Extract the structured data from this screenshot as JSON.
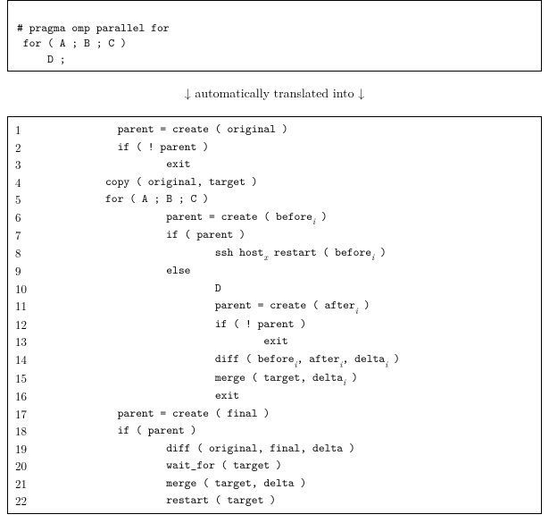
{
  "source_block": {
    "line1": "# pragma omp parallel for",
    "line2": " for ( A ; B ; C )",
    "line3": "     D ;"
  },
  "caption": {
    "arrow_left": "↓",
    "text": " automatically translated into ",
    "arrow_right": "↓"
  },
  "translated_block": {
    "lines": [
      {
        "n": "1",
        "indent": "        ",
        "text": "parent = create ( original )"
      },
      {
        "n": "2",
        "indent": "        ",
        "text": "if ( ! parent )"
      },
      {
        "n": "3",
        "indent": "                ",
        "text": "exit"
      },
      {
        "n": "4",
        "indent": "      ",
        "text": "copy ( original, target )"
      },
      {
        "n": "5",
        "indent": "      ",
        "text": "for ( A ; B ; C )"
      },
      {
        "n": "6",
        "indent": "                ",
        "text_parts": [
          "parent = create ( before",
          {
            "sub": "i"
          },
          " )"
        ]
      },
      {
        "n": "7",
        "indent": "                ",
        "text": "if ( parent )"
      },
      {
        "n": "8",
        "indent": "                        ",
        "text_parts": [
          "ssh host",
          {
            "sub": "x"
          },
          " restart ( before",
          {
            "sub": "i"
          },
          " )"
        ]
      },
      {
        "n": "9",
        "indent": "                ",
        "text": "else"
      },
      {
        "n": "10",
        "indent": "                        ",
        "text": "D"
      },
      {
        "n": "11",
        "indent": "                        ",
        "text_parts": [
          "parent = create ( after",
          {
            "sub": "i"
          },
          " )"
        ]
      },
      {
        "n": "12",
        "indent": "                        ",
        "text": "if ( ! parent )"
      },
      {
        "n": "13",
        "indent": "                                ",
        "text": "exit"
      },
      {
        "n": "14",
        "indent": "                        ",
        "text_parts": [
          "diff ( before",
          {
            "sub": "i"
          },
          ", after",
          {
            "sub": "i"
          },
          ", delta",
          {
            "sub": "i"
          },
          " )"
        ]
      },
      {
        "n": "15",
        "indent": "                        ",
        "text_parts": [
          "merge ( target, delta",
          {
            "sub": "i"
          },
          " )"
        ]
      },
      {
        "n": "16",
        "indent": "                        ",
        "text": "exit"
      },
      {
        "n": "17",
        "indent": "        ",
        "text": "parent = create ( final )"
      },
      {
        "n": "18",
        "indent": "        ",
        "text": "if ( parent )"
      },
      {
        "n": "19",
        "indent": "                ",
        "text": "diff ( original, final, delta )"
      },
      {
        "n": "20",
        "indent": "                ",
        "text": "wait_for ( target )"
      },
      {
        "n": "21",
        "indent": "                ",
        "text": "merge ( target, delta )"
      },
      {
        "n": "22",
        "indent": "                ",
        "text": "restart ( target )"
      }
    ]
  }
}
